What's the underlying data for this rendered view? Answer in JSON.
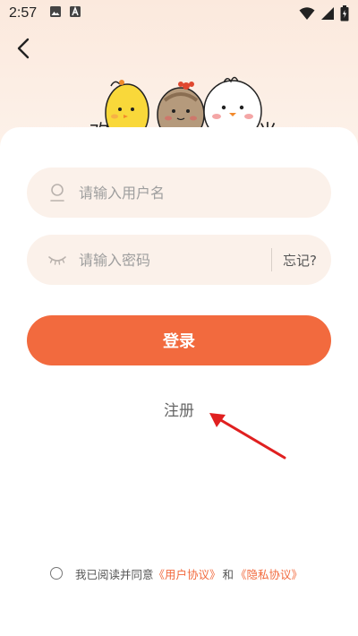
{
  "status_bar": {
    "time": "2:57"
  },
  "mascot_text": {
    "left": "欢",
    "right": "光"
  },
  "form": {
    "username_placeholder": "请输入用户名",
    "password_placeholder": "请输入密码",
    "forgot_label": "忘记?",
    "login_label": "登录",
    "register_label": "注册"
  },
  "agreement": {
    "prefix": "我已阅读并同意",
    "user_agreement": "《用户协议》",
    "and": "和",
    "privacy_agreement": "《隐私协议》"
  },
  "colors": {
    "accent": "#f26a3e",
    "field_bg": "#fbf1ea",
    "annotation_arrow": "#e02020"
  }
}
